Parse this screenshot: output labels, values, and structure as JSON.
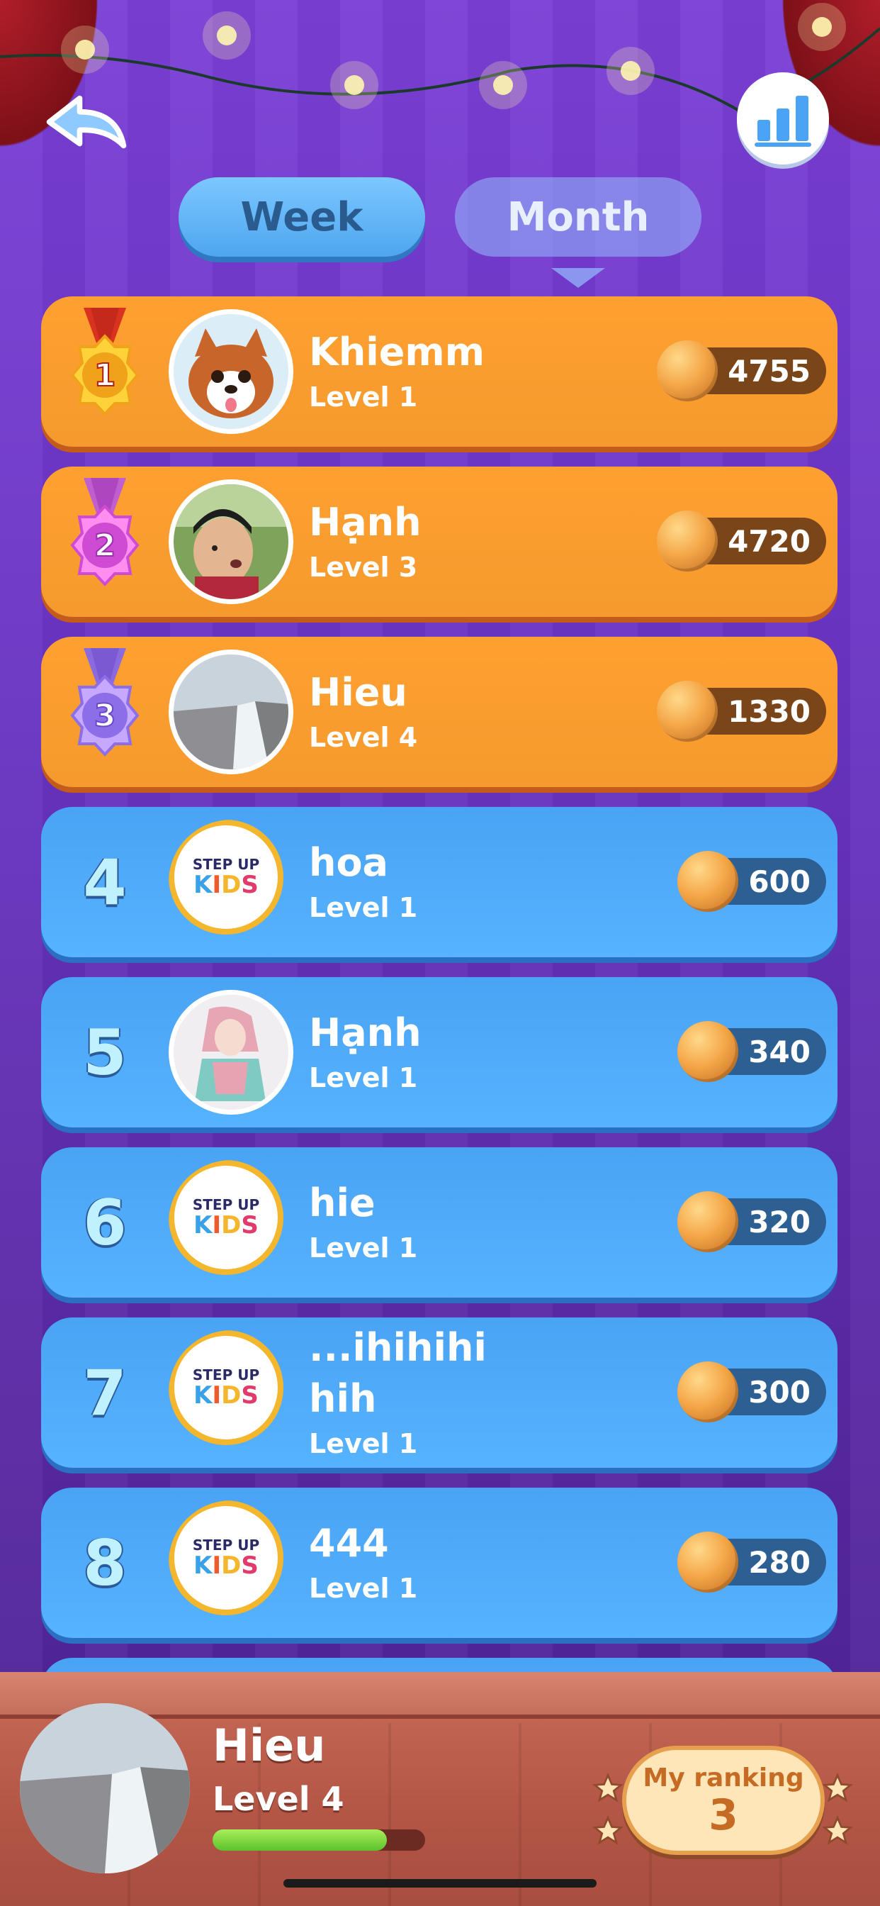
{
  "tabs": [
    {
      "label": "Week",
      "active": true
    },
    {
      "label": "Month",
      "active": false
    }
  ],
  "icons": {
    "back": "back-arrow-icon",
    "stats": "bar-chart-icon",
    "coin": "coin-icon",
    "medal_1": "gold-medal-icon",
    "medal_2": "pink-medal-icon",
    "medal_3": "purple-medal-icon"
  },
  "leaderboard": [
    {
      "rank": "1",
      "name": "Khiemm",
      "level": "Level 1",
      "score": "4755",
      "style": "gold",
      "avatar": "dog"
    },
    {
      "rank": "2",
      "name": "Hạnh",
      "level": "Level 3",
      "score": "4720",
      "style": "gold",
      "avatar": "kid"
    },
    {
      "rank": "3",
      "name": "Hieu",
      "level": "Level 4",
      "score": "1330",
      "style": "gold",
      "avatar": "waterfall"
    },
    {
      "rank": "4",
      "name": "hoa",
      "level": "Level 1",
      "score": "600",
      "style": "blue",
      "avatar": "logo"
    },
    {
      "rank": "5",
      "name": "Hạnh",
      "level": "Level 1",
      "score": "340",
      "style": "blue",
      "avatar": "drawing"
    },
    {
      "rank": "6",
      "name": "hie",
      "level": "Level 1",
      "score": "320",
      "style": "blue",
      "avatar": "logo"
    },
    {
      "rank": "7",
      "name": "...ihihihi\nhih",
      "level": "Level 1",
      "score": "300",
      "style": "blue",
      "avatar": "logo"
    },
    {
      "rank": "8",
      "name": "444",
      "level": "Level 1",
      "score": "280",
      "style": "blue",
      "avatar": "logo"
    }
  ],
  "logo_text": {
    "top": "STEP UP",
    "bottom": "KIDS"
  },
  "me": {
    "name": "Hieu",
    "level": "Level 4",
    "xp_progress": 0.82,
    "ranking_label": "My ranking",
    "ranking_value": "3"
  },
  "colors": {
    "gold_row": "#f59a2e",
    "blue_row": "#4aa3f4",
    "background": "#6a35c4"
  }
}
